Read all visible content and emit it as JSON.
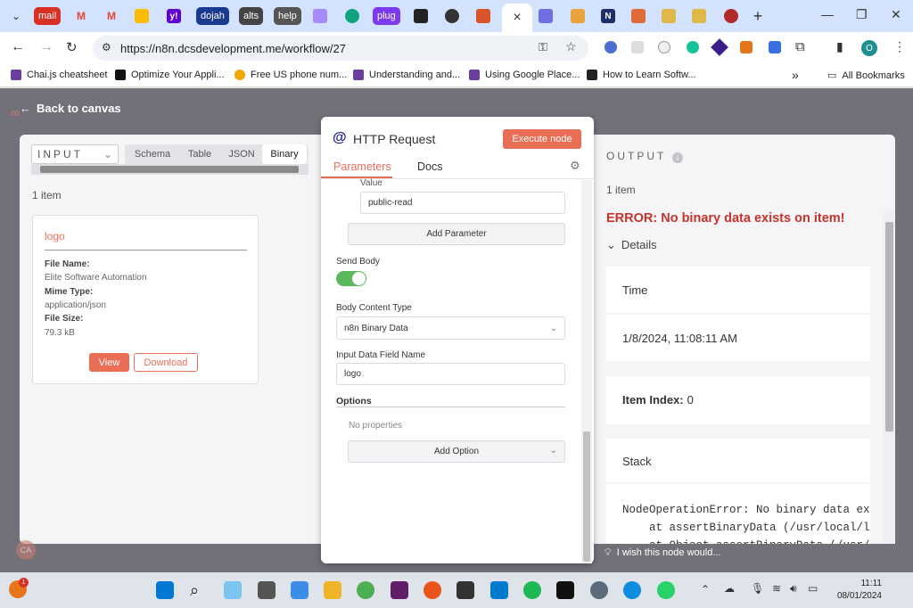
{
  "browser": {
    "tabs": [
      {
        "name": "tab-mail",
        "label": "mail",
        "color": "#d93025"
      },
      {
        "name": "tab-gmail-1",
        "label": "M",
        "color": "#ea4335"
      },
      {
        "name": "tab-gmail-2",
        "label": "M",
        "color": "#ea4335"
      },
      {
        "name": "tab-gmail-3",
        "label": "M",
        "color": "#fbbc04"
      },
      {
        "name": "tab-yahoo",
        "label": "y!",
        "color": "#6001d2"
      },
      {
        "name": "tab-dojah",
        "label": "dojah",
        "color": "#1a3a8f"
      },
      {
        "name": "tab-alts",
        "label": "alts",
        "color": "#444444"
      },
      {
        "name": "tab-help",
        "label": "help",
        "color": "#555555"
      },
      {
        "name": "tab-app",
        "label": "",
        "color": "#a78bfa"
      },
      {
        "name": "tab-openai",
        "label": "",
        "color": "#10a37f"
      },
      {
        "name": "tab-plug",
        "label": "plug",
        "color": "#7c3aed"
      },
      {
        "name": "tab-app-2",
        "label": "",
        "color": "#222222"
      },
      {
        "name": "tab-app-3",
        "label": "",
        "color": "#333333"
      },
      {
        "name": "tab-app-4",
        "label": "",
        "color": "#d9542b"
      },
      {
        "name": "tab-n8n-active",
        "label": "",
        "color": "#ffffff"
      },
      {
        "name": "tab-n8n-2",
        "label": "",
        "color": "#6f6fe0"
      },
      {
        "name": "tab-app-5",
        "label": "",
        "color": "#e8a33a"
      },
      {
        "name": "tab-notion",
        "label": "N",
        "color": "#1f2d6b"
      },
      {
        "name": "tab-app-6",
        "label": "",
        "color": "#e06b3a"
      },
      {
        "name": "tab-app-7",
        "label": "",
        "color": "#e0b84a"
      },
      {
        "name": "tab-app-8",
        "label": "",
        "color": "#e0b84a"
      },
      {
        "name": "tab-app-9",
        "label": "",
        "color": "#b02a2a"
      }
    ],
    "active_tab_close": "×",
    "new_tab": "+",
    "url": "https://n8n.dcsdevelopment.me/workflow/27",
    "profile_initial": "O",
    "bookmarks": [
      {
        "label": "Chai.js cheatsheet",
        "color": "#6b3fa0"
      },
      {
        "label": "Optimize Your Appli...",
        "color": "#111111"
      },
      {
        "label": "Free US phone num...",
        "color": "#f0a500"
      },
      {
        "label": "Understanding and...",
        "color": "#6b3fa0"
      },
      {
        "label": "Using Google Place...",
        "color": "#6b3fa0"
      },
      {
        "label": "How to Learn Softw...",
        "color": "#222222"
      }
    ],
    "bookmarks_overflow": "»",
    "all_bookmarks": "All Bookmarks"
  },
  "n8n": {
    "back_label": "Back to canvas",
    "input": {
      "title": "INPUT",
      "tabs": [
        "Schema",
        "Table",
        "JSON",
        "Binary"
      ],
      "active_tab": "Binary",
      "item_count": "1 item",
      "binary_card": {
        "name": "logo",
        "file_name_label": "File Name:",
        "file_name": "Elite Software Automation",
        "mime_label": "Mime Type:",
        "mime": "application/json",
        "size_label": "File Size:",
        "size": "79.3 kB",
        "view_label": "View",
        "download_label": "Download"
      }
    },
    "node": {
      "icon": "@",
      "title": "HTTP Request",
      "execute_label": "Execute node",
      "tabs": [
        "Parameters",
        "Docs"
      ],
      "active_tab": "Parameters",
      "value_label": "Value",
      "value": "public-read",
      "add_parameter_label": "Add Parameter",
      "send_body_label": "Send Body",
      "send_body_on": true,
      "body_content_type_label": "Body Content Type",
      "body_content_type": "n8n Binary Data",
      "input_field_label": "Input Data Field Name",
      "input_field_value": "logo",
      "options_label": "Options",
      "no_properties": "No properties",
      "add_option_label": "Add Option"
    },
    "output": {
      "title": "OUTPUT",
      "item_count": "1 item",
      "error": "ERROR: No binary data exists on item!",
      "details_label": "Details",
      "time_label": "Time",
      "time_value": "1/8/2024, 11:08:11 AM",
      "item_index_label": "Item Index:",
      "item_index_value": "0",
      "stack_label": "Stack",
      "stack_lines": [
        "NodeOperationError: No binary data ex",
        "    at assertBinaryData (/usr/local/l",
        "    at Object.assertBinaryData (/usr/"
      ]
    },
    "feedback": "I wish this node would..."
  },
  "taskbar": {
    "time": "11:11",
    "date": "08/01/2024",
    "notification_badge": "1"
  },
  "colors": {
    "accent": "#ea6e55",
    "error": "#c9322a",
    "toggle": "#5cb85c"
  }
}
